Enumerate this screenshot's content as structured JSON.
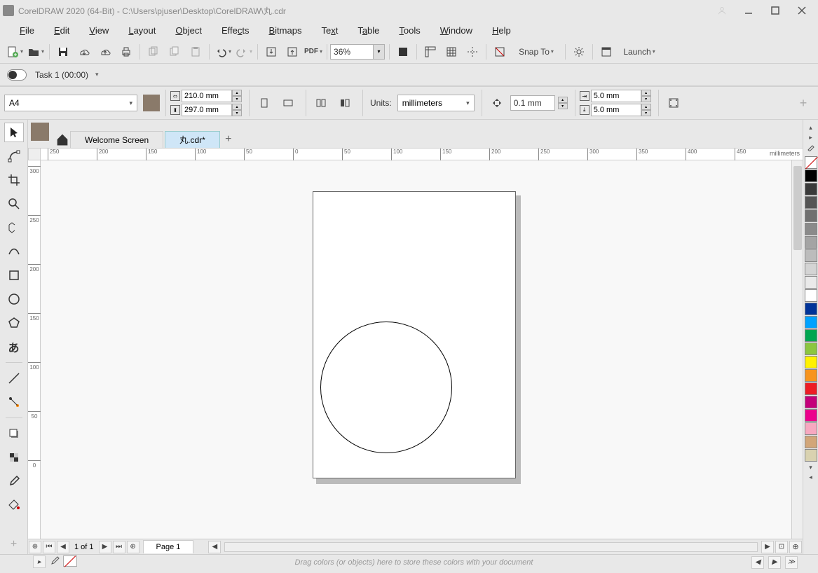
{
  "title": "CorelDRAW 2020 (64-Bit) - C:\\Users\\pjuser\\Desktop\\CorelDRAW\\丸.cdr",
  "menu": [
    "File",
    "Edit",
    "View",
    "Layout",
    "Object",
    "Effects",
    "Bitmaps",
    "Text",
    "Table",
    "Tools",
    "Window",
    "Help"
  ],
  "toolbar": {
    "zoom": "36%",
    "snap_to": "Snap To",
    "launch": "Launch"
  },
  "taskbar": {
    "task": "Task 1 (00:00)"
  },
  "propbar": {
    "paper": "A4",
    "width": "210.0 mm",
    "height": "297.0 mm",
    "units_label": "Units:",
    "units": "millimeters",
    "nudge": "0.1 mm",
    "dup_x": "5.0 mm",
    "dup_y": "5.0 mm"
  },
  "doctabs": {
    "welcome": "Welcome Screen",
    "active": "丸.cdr*"
  },
  "ruler": {
    "h": [
      "250",
      "200",
      "150",
      "100",
      "50",
      "0",
      "50",
      "100",
      "150",
      "200",
      "250",
      "300",
      "350",
      "400",
      "450"
    ],
    "units": "millimeters",
    "v": [
      "300",
      "250",
      "200",
      "150",
      "100",
      "50",
      "0"
    ]
  },
  "pagenav": {
    "label": "1  of  1",
    "page_tab": "Page 1"
  },
  "colordrop": {
    "hint": "Drag colors (or objects) here to store these colors with your document"
  },
  "palette": [
    "#000000",
    "#3a3a3a",
    "#555555",
    "#707070",
    "#8a8a8a",
    "#a4a4a4",
    "#bcbcbc",
    "#d4d4d4",
    "#eaeaea",
    "#ffffff",
    "#003399",
    "#00a2ff",
    "#00a651",
    "#8cc63f",
    "#fff200",
    "#f7941d",
    "#ed1c24",
    "#c4007a",
    "#ec008c",
    "#f7a8c0",
    "#d2a679",
    "#d9d2b0"
  ]
}
